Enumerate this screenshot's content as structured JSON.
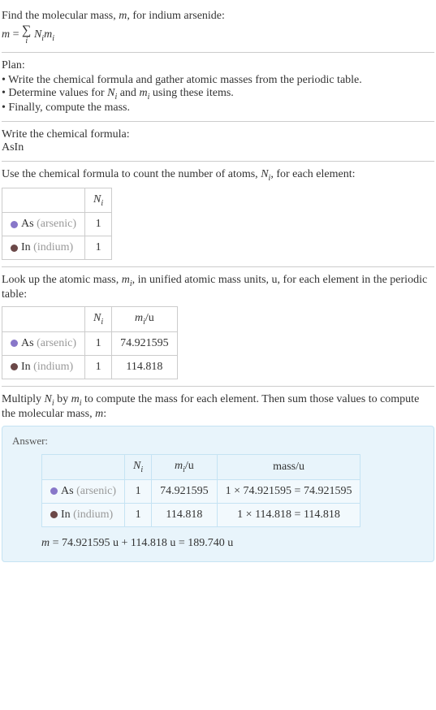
{
  "intro": {
    "line1_pre": "Find the molecular mass, ",
    "line1_var": "m",
    "line1_post": ", for indium arsenide:",
    "formula_lhs": "m",
    "formula_eq": " = ",
    "formula_sumvar": "i",
    "formula_rhs1": "N",
    "formula_rhs1_sub": "i",
    "formula_rhs2": "m",
    "formula_rhs2_sub": "i"
  },
  "plan": {
    "title": "Plan:",
    "items": [
      "Write the chemical formula and gather atomic masses from the periodic table.",
      "Determine values for N_i and m_i using these items.",
      "Finally, compute the mass."
    ],
    "item0": "Write the chemical formula and gather atomic masses from the periodic table.",
    "item1_pre": "Determine values for ",
    "item1_n": "N",
    "item1_i": "i",
    "item1_and": " and ",
    "item1_m": "m",
    "item1_post": " using these items.",
    "item2": "Finally, compute the mass."
  },
  "chemformula": {
    "title": "Write the chemical formula:",
    "value": "AsIn"
  },
  "count": {
    "title_pre": "Use the chemical formula to count the number of atoms, ",
    "title_n": "N",
    "title_i": "i",
    "title_post": ", for each element:",
    "header_n": "N",
    "header_i": "i",
    "rows": [
      {
        "dot": "purple",
        "sym": "As",
        "name": "(arsenic)",
        "n": "1"
      },
      {
        "dot": "brown",
        "sym": "In",
        "name": "(indium)",
        "n": "1"
      }
    ]
  },
  "lookup": {
    "title_pre": "Look up the atomic mass, ",
    "title_m": "m",
    "title_i": "i",
    "title_post": ", in unified atomic mass units, u, for each element in the periodic table:",
    "header_n": "N",
    "header_ni": "i",
    "header_m": "m",
    "header_mi": "i",
    "header_u": "/u",
    "rows": [
      {
        "dot": "purple",
        "sym": "As",
        "name": "(arsenic)",
        "n": "1",
        "m": "74.921595"
      },
      {
        "dot": "brown",
        "sym": "In",
        "name": "(indium)",
        "n": "1",
        "m": "114.818"
      }
    ]
  },
  "multiply": {
    "text_pre": "Multiply ",
    "text_n": "N",
    "text_ni": "i",
    "text_by": " by ",
    "text_m": "m",
    "text_mi": "i",
    "text_mid": " to compute the mass for each element. Then sum those values to compute the molecular mass, ",
    "text_mvar": "m",
    "text_post": ":"
  },
  "answer": {
    "label": "Answer:",
    "header_n": "N",
    "header_ni": "i",
    "header_m": "m",
    "header_mi": "i",
    "header_mu": "/u",
    "header_mass": "mass/u",
    "rows": [
      {
        "dot": "purple",
        "sym": "As",
        "name": "(arsenic)",
        "n": "1",
        "m": "74.921595",
        "mass": "1 × 74.921595 = 74.921595"
      },
      {
        "dot": "brown",
        "sym": "In",
        "name": "(indium)",
        "n": "1",
        "m": "114.818",
        "mass": "1 × 114.818 = 114.818"
      }
    ],
    "final_m": "m",
    "final_eq": " = 74.921595 u + 114.818 u = 189.740 u"
  }
}
